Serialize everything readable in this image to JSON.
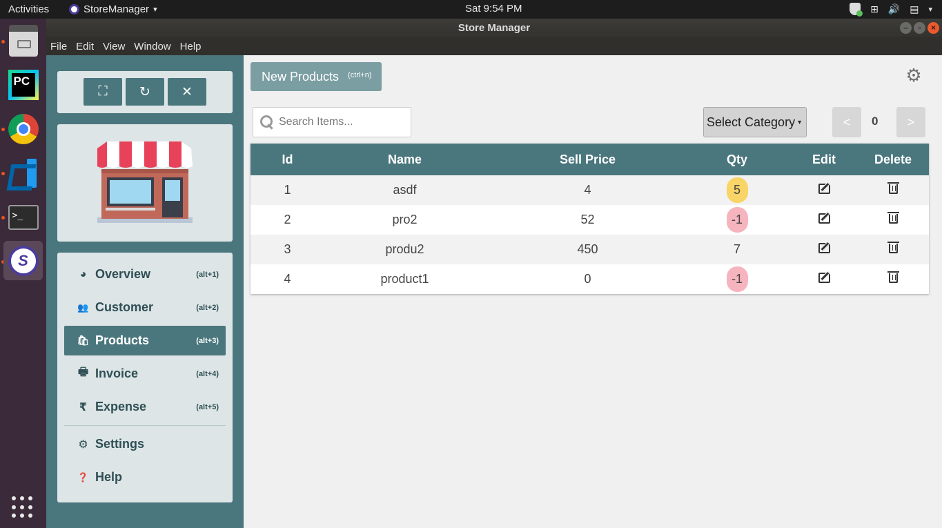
{
  "topbar": {
    "activities": "Activities",
    "app_name": "StoreManager",
    "app_caret": "▾",
    "clock": "Sat  9:54 PM",
    "tray_caret": "▾"
  },
  "window": {
    "title": "Store Manager",
    "minimize": "–",
    "maximize": "▫",
    "close": "×"
  },
  "menubar": [
    "File",
    "Edit",
    "View",
    "Window",
    "Help"
  ],
  "dock": {
    "terminal_prompt": ">_",
    "pycharm_label": "PC",
    "store_label": "S"
  },
  "sidebar": {
    "controls": [
      {
        "icon": "fullscreen-icon",
        "glyph": "⛶"
      },
      {
        "icon": "refresh-icon",
        "glyph": "↻"
      },
      {
        "icon": "close-icon",
        "glyph": "✕"
      }
    ],
    "nav": [
      {
        "label": "Overview",
        "shortcut": "(alt+1)",
        "icon": "pie-chart-icon",
        "glyph": "◕"
      },
      {
        "label": "Customer",
        "shortcut": "(alt+2)",
        "icon": "users-icon",
        "glyph": "👥"
      },
      {
        "label": "Products",
        "shortcut": "(alt+3)",
        "icon": "shopping-bag-icon",
        "glyph": "🛍"
      },
      {
        "label": "Invoice",
        "shortcut": "(alt+4)",
        "icon": "printer-icon",
        "glyph": "🖶"
      },
      {
        "label": "Expense",
        "shortcut": "(alt+5)",
        "icon": "rupee-icon",
        "glyph": "₹"
      }
    ],
    "nav_secondary": [
      {
        "label": "Settings",
        "icon": "gear-icon",
        "glyph": "⚙"
      },
      {
        "label": "Help",
        "icon": "question-circle-icon",
        "glyph": "❓"
      }
    ],
    "active_nav": "Products"
  },
  "toolbar": {
    "new_label": "New Products",
    "new_shortcut": "(ctrl+n)",
    "settings_glyph": "⚙"
  },
  "search": {
    "placeholder": "Search Items...",
    "value": ""
  },
  "category": {
    "selected": "Select Category",
    "caret": "▾"
  },
  "pagination": {
    "prev": "<",
    "page": "0",
    "next": ">"
  },
  "table": {
    "columns": [
      "Id",
      "Name",
      "Sell Price",
      "Qty",
      "Edit",
      "Delete"
    ],
    "rows": [
      {
        "id": "1",
        "name": "asdf",
        "price": "4",
        "qty": "5",
        "qty_status": "warn"
      },
      {
        "id": "2",
        "name": "pro2",
        "price": "52",
        "qty": "-1",
        "qty_status": "danger"
      },
      {
        "id": "3",
        "name": "produ2",
        "price": "450",
        "qty": "7",
        "qty_status": "plain"
      },
      {
        "id": "4",
        "name": "product1",
        "price": "0",
        "qty": "-1",
        "qty_status": "danger"
      }
    ]
  },
  "colors": {
    "accent": "#4a767d",
    "warn": "#f9d466",
    "danger": "#f6b4be"
  }
}
